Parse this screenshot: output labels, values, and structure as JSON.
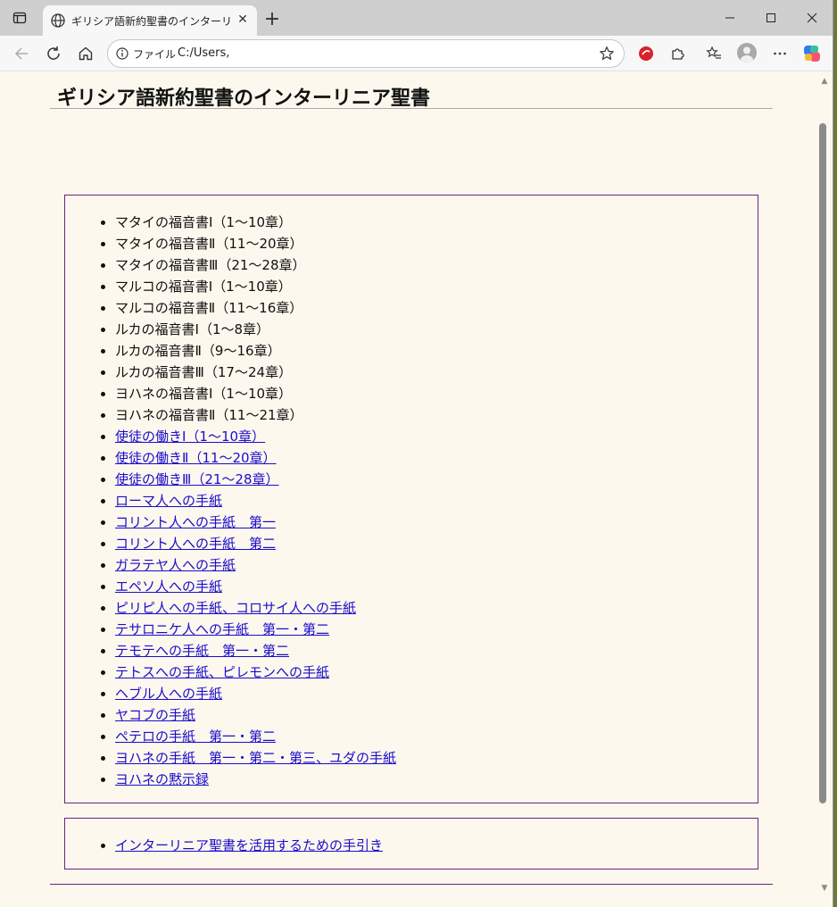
{
  "browser": {
    "tab_title": "ギリシア語新約聖書のインターリニア聖",
    "tab_close": "✕",
    "new_tab": "+",
    "address_scheme": "ファイル",
    "address_url": "C:/Users,"
  },
  "page": {
    "title": "ギリシア語新約聖書のインターリニア聖書",
    "books_plain": [
      "マタイの福音書Ⅰ（1～10章）",
      "マタイの福音書Ⅱ（11～20章）",
      "マタイの福音書Ⅲ（21～28章）",
      "マルコの福音書Ⅰ（1～10章）",
      "マルコの福音書Ⅱ（11～16章）",
      "ルカの福音書Ⅰ（1～8章）",
      "ルカの福音書Ⅱ（9～16章）",
      "ルカの福音書Ⅲ（17～24章）",
      "ヨハネの福音書Ⅰ（1～10章）",
      "ヨハネの福音書Ⅱ（11～21章）"
    ],
    "books_links": [
      "使徒の働きⅠ（1～10章）",
      "使徒の働きⅡ（11～20章）",
      "使徒の働きⅢ（21～28章）",
      "ローマ人への手紙",
      "コリント人への手紙　第一",
      "コリント人への手紙　第二",
      "ガラテヤ人への手紙",
      "エペソ人への手紙",
      "ピリピ人への手紙、コロサイ人への手紙",
      "テサロニケ人への手紙　第一・第二",
      "テモテへの手紙　第一・第二",
      "テトスへの手紙、ピレモンへの手紙",
      "ヘブル人への手紙",
      "ヤコブの手紙",
      "ペテロの手紙　第一・第二",
      "ヨハネの手紙　第一・第二・第三、ユダの手紙",
      "ヨハネの黙示録"
    ],
    "guide_link": "インターリニア聖書を活用するための手引き"
  }
}
